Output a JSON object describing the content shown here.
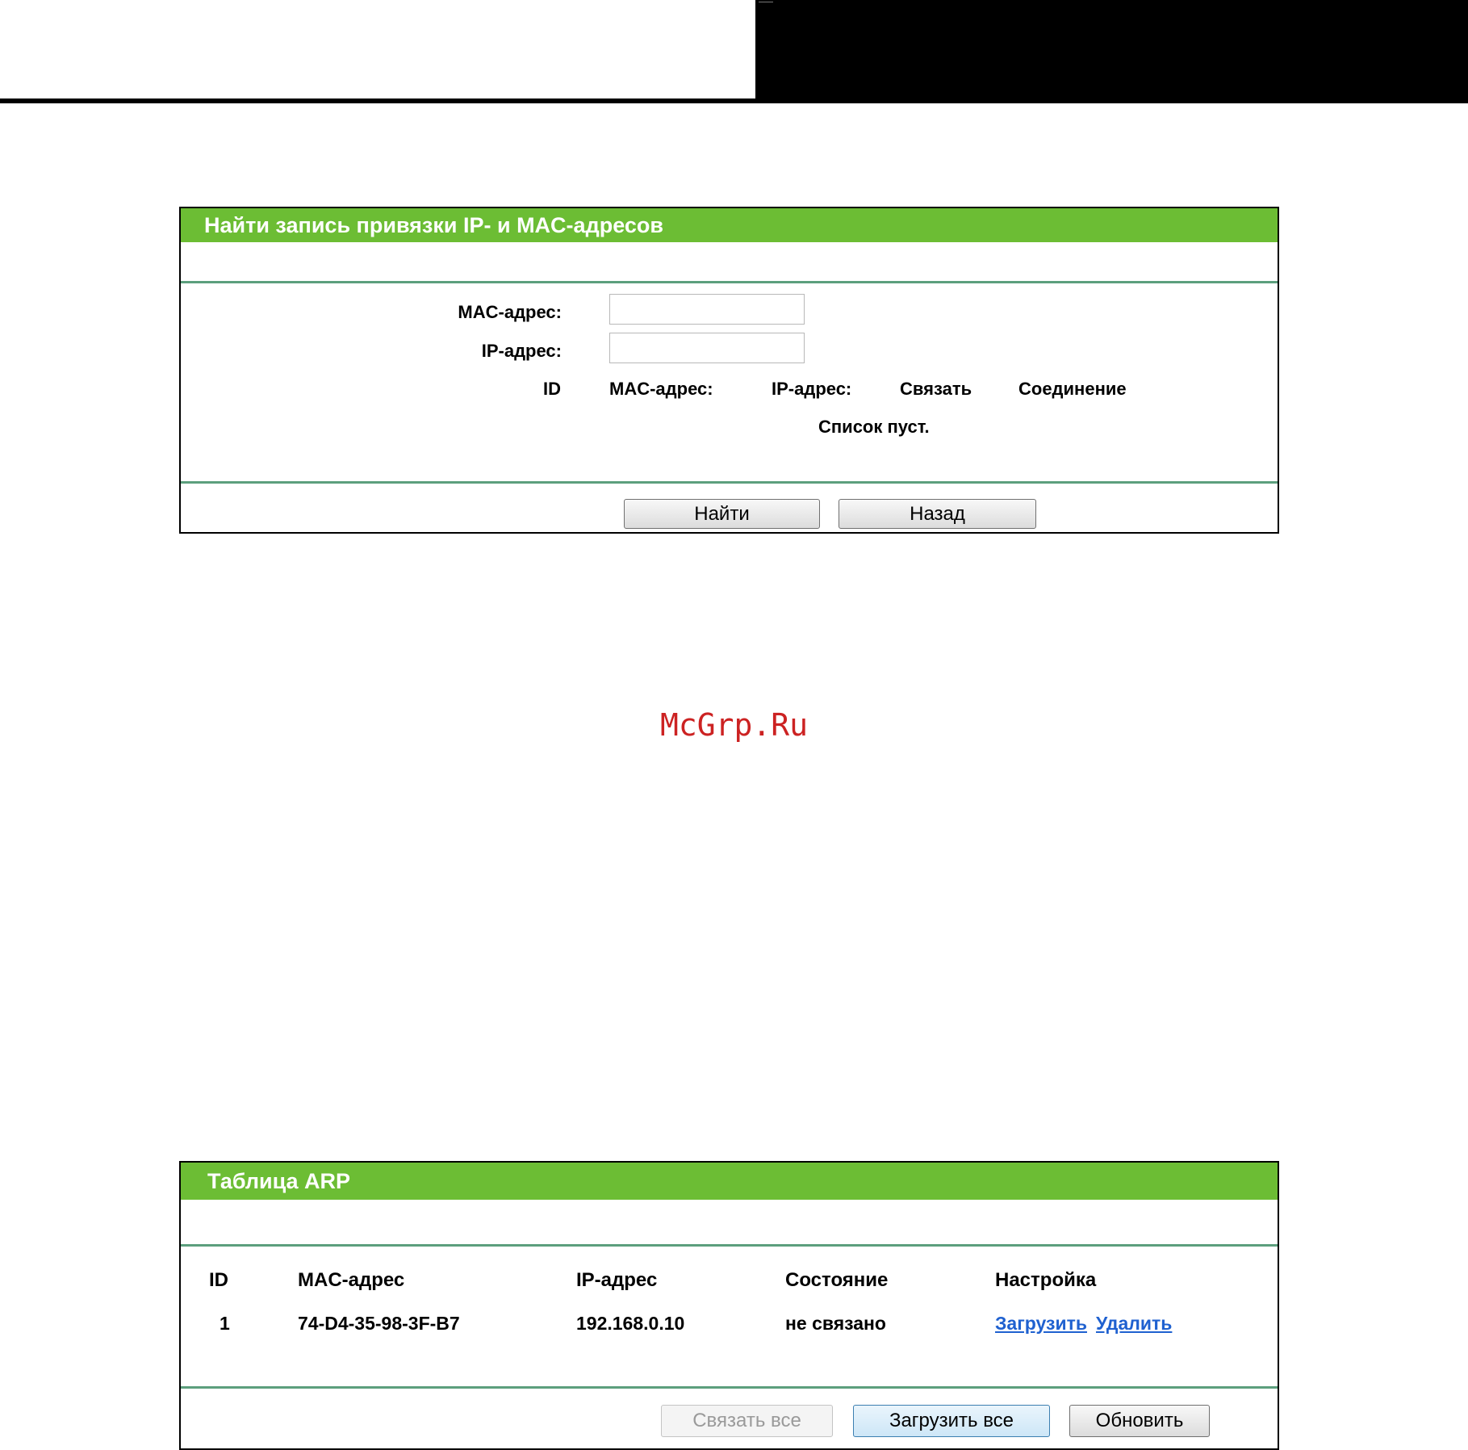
{
  "search_panel": {
    "title": "Найти запись привязки IP- и MAC-адресов",
    "mac_label": "MAC-адрес:",
    "ip_label": "IP-адрес:",
    "mac_value": "",
    "ip_value": "",
    "columns": [
      "ID",
      "MAC-адрес:",
      "IP-адрес:",
      "Связать",
      "Соединение"
    ],
    "empty_message": "Список пуст.",
    "find_button": "Найти",
    "back_button": "Назад"
  },
  "watermark": "McGrp.Ru",
  "arp_panel": {
    "title": "Таблица ARP",
    "columns": [
      "ID",
      "MAC-адрес",
      "IP-адрес",
      "Состояние",
      "Настройка"
    ],
    "rows": [
      {
        "id": "1",
        "mac": "74-D4-35-98-3F-B7",
        "ip": "192.168.0.10",
        "state": "не связано",
        "load": "Загрузить",
        "delete": "Удалить"
      }
    ],
    "bind_all_button": "Связать все",
    "load_all_button": "Загрузить все",
    "refresh_button": "Обновить"
  },
  "colors": {
    "header_green": "#6cbd34",
    "separator": "#5c9f7d",
    "link": "#1f61d0"
  }
}
